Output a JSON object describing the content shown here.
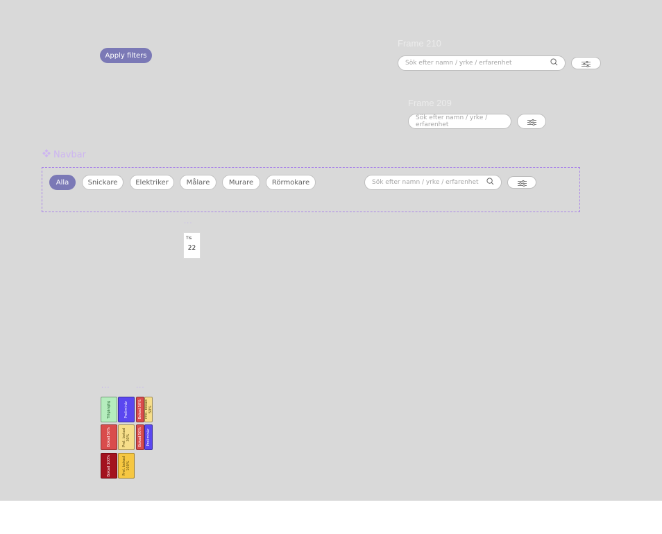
{
  "colors": {
    "canvas": "#d9d9d9",
    "accent": "#7b79b6",
    "navbar_outline": "#a983e8",
    "frame_title": "#ececec",
    "navbar_label": "#cdb5f1"
  },
  "apply_filters": {
    "label": "Apply filters"
  },
  "frame210": {
    "title": "Frame 210",
    "search_placeholder": "Sök efter namn / yrke / erfarenhet",
    "search_icon": "search-icon",
    "filter_icon": "sliders-icon"
  },
  "frame209": {
    "title": "Frame 209",
    "search_placeholder": "Sök efter namn / yrke / erfarenhet",
    "filter_icon": "sliders-icon"
  },
  "navbar": {
    "label": "Navbar",
    "component_icon": "component-icon",
    "chips": [
      {
        "label": "Alla",
        "active": true
      },
      {
        "label": "Snickare",
        "active": false
      },
      {
        "label": "Elektriker",
        "active": false
      },
      {
        "label": "Målare",
        "active": false
      },
      {
        "label": "Murare",
        "active": false
      },
      {
        "label": "Rörmokare",
        "active": false
      }
    ],
    "search_placeholder": "Sök efter namn / yrke / erfarenhet",
    "search_icon": "search-icon",
    "filter_icon": "sliders-icon"
  },
  "date_card": {
    "day": "Tis",
    "date": "22"
  },
  "group_dots": "...",
  "tags": [
    {
      "label": "Tillgänglig",
      "color": "#b5edbd",
      "text_color": "#1f5e2a"
    },
    {
      "label": "Preliminär",
      "color": "#5a47f0",
      "text_color": "#ffffff"
    },
    {
      "label": "Bokad 50%",
      "color": "#d94c4c",
      "text_color": "#ffffff"
    },
    {
      "label": "Prel. bokad 50%",
      "color": "#f6de8a",
      "text_color": "#5a4a10"
    },
    {
      "label": "Bokad 50%",
      "color": "#d94c4c",
      "text_color": "#ffffff"
    },
    {
      "label": "Prel. bokad\n30%",
      "color": "#f6de8a",
      "text_color": "#5a4a10"
    },
    {
      "label": "Bokad 50%",
      "color": "#d94c4c",
      "text_color": "#ffffff"
    },
    {
      "label": "Preliminär",
      "color": "#5a47f0",
      "text_color": "#ffffff"
    },
    {
      "label": "Bokad 100%",
      "color": "#a3121e",
      "text_color": "#ffffff"
    },
    {
      "label": "Prel. bokad\n100%",
      "color": "#f6c742",
      "text_color": "#5a4a10"
    }
  ]
}
